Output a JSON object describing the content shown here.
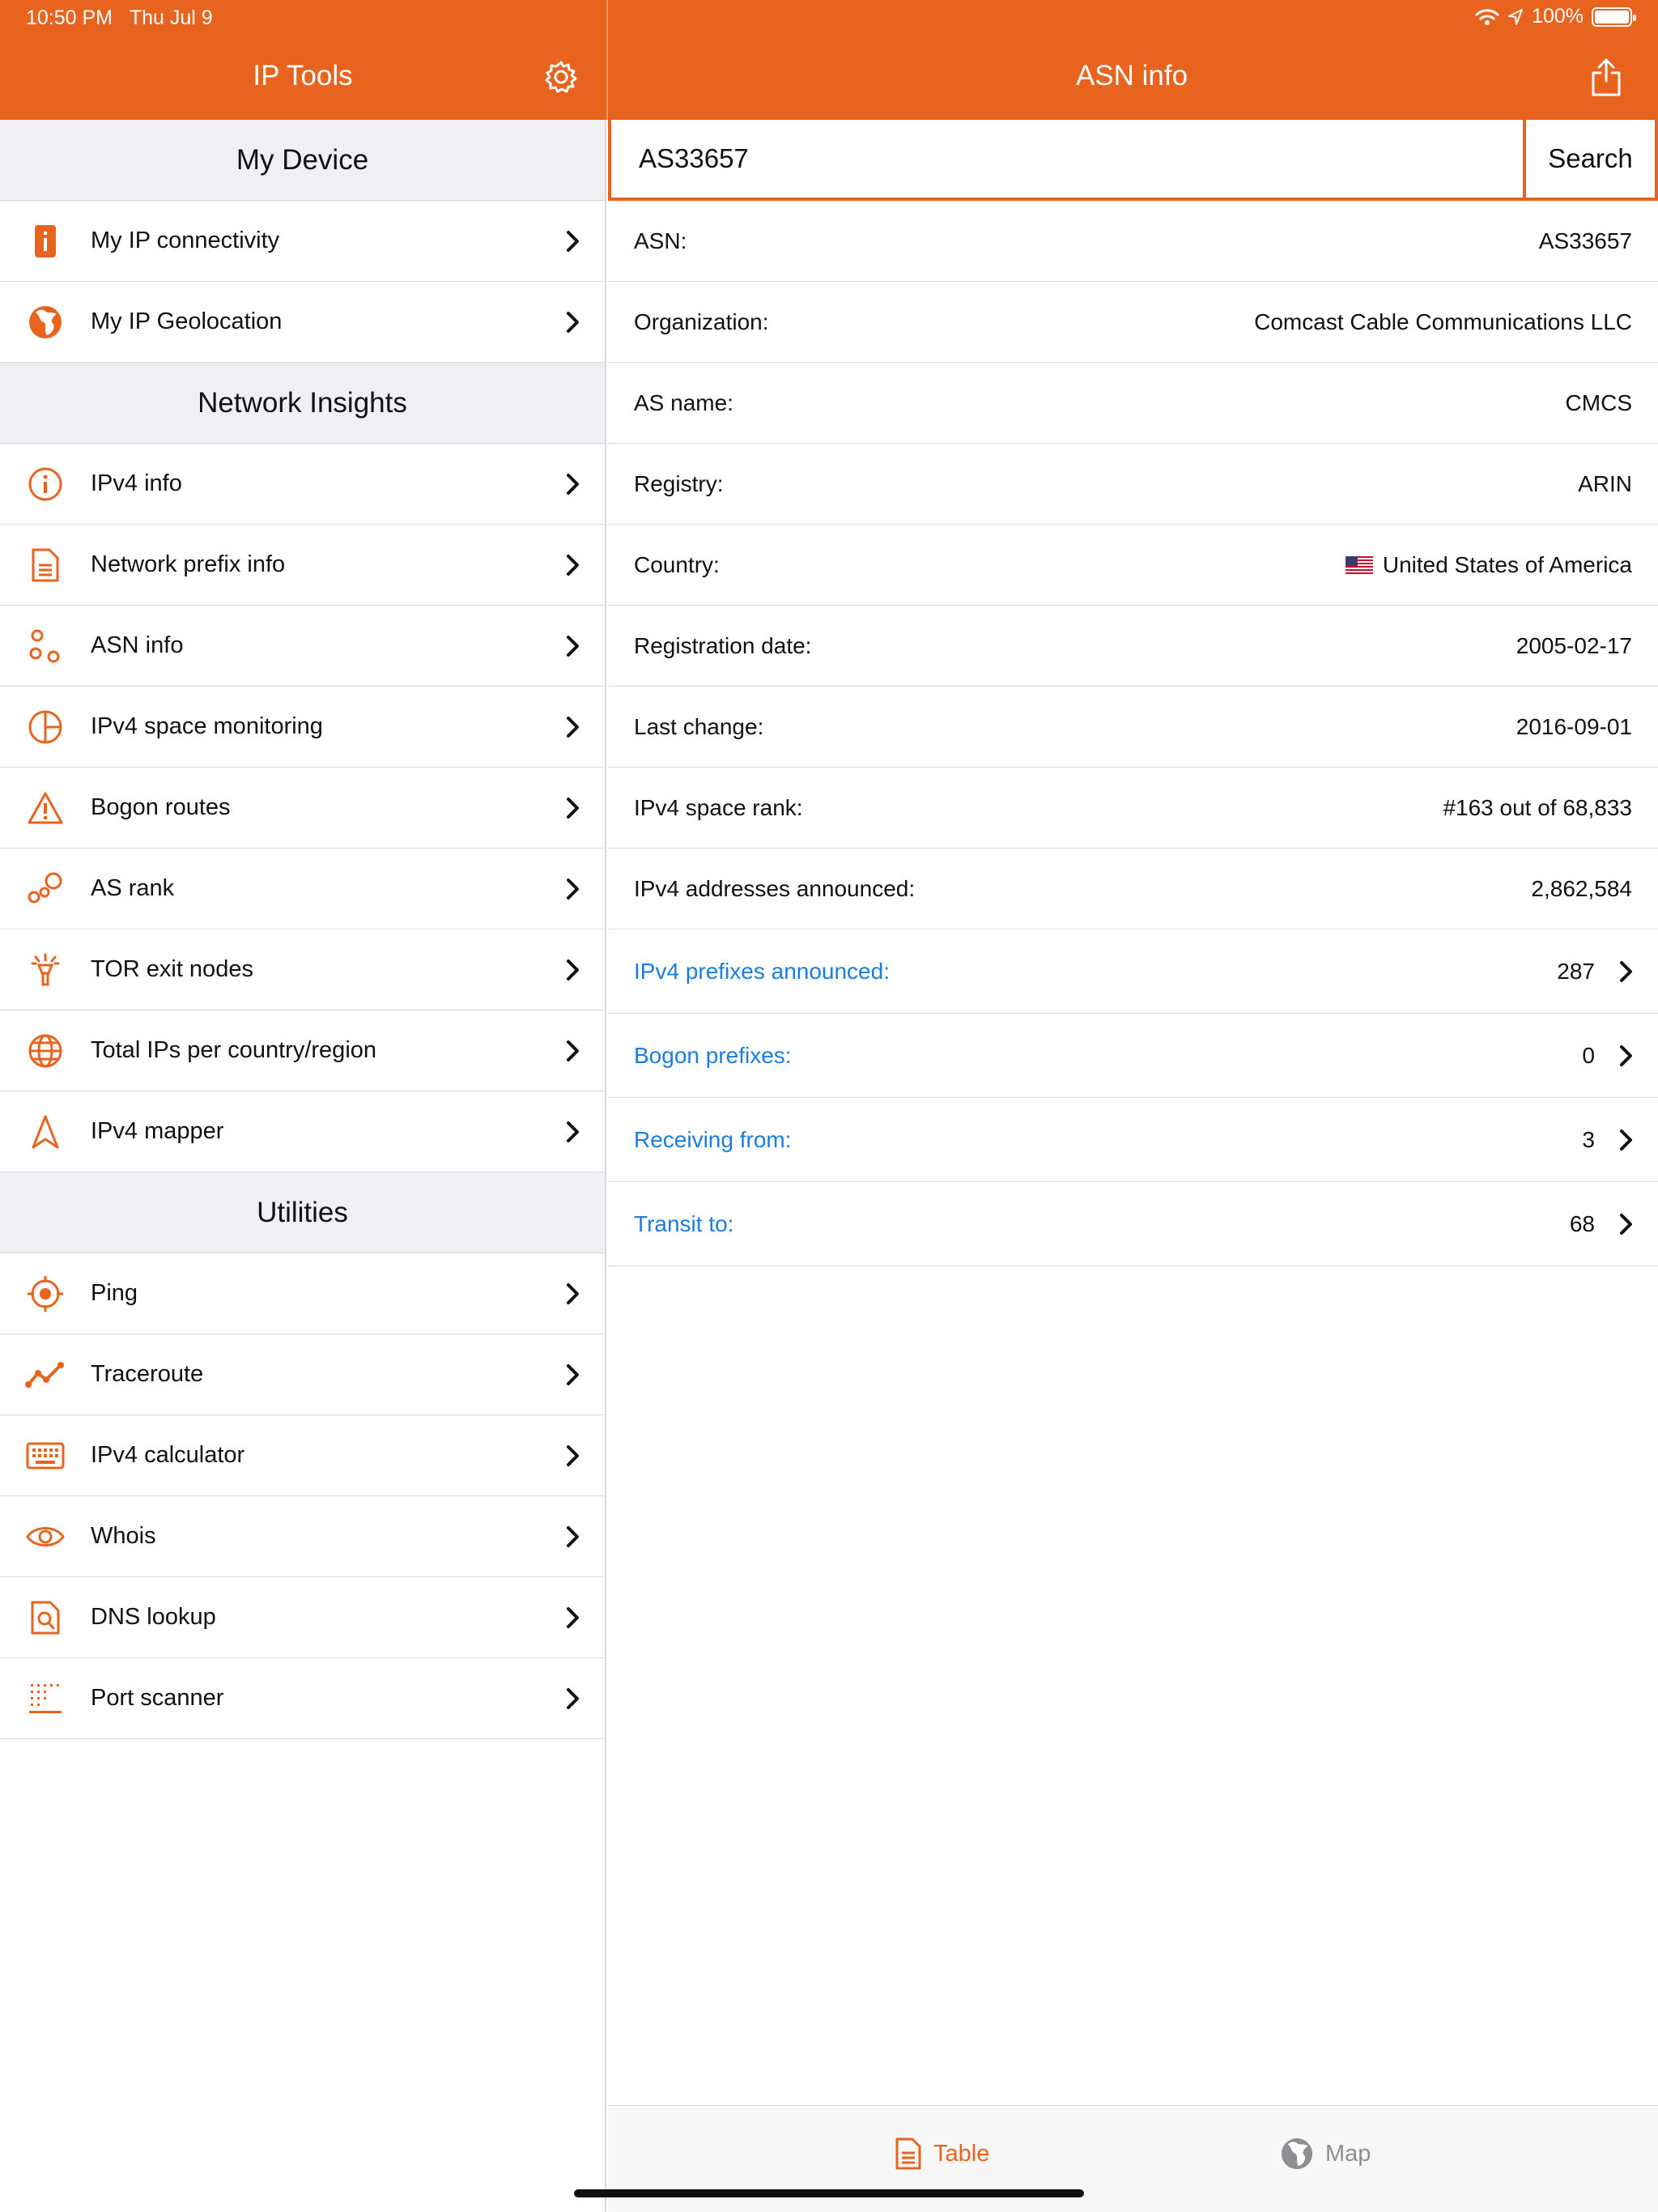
{
  "status_bar": {
    "time": "10:50 PM",
    "date": "Thu Jul 9",
    "battery_text": "100%",
    "battery_level": 1.0
  },
  "nav_left": {
    "title": "IP Tools",
    "settings_icon": "gear-icon"
  },
  "nav_right": {
    "title": "ASN info",
    "share_icon": "share-icon"
  },
  "colors": {
    "accent": "#e8641e",
    "link": "#1a7de0",
    "header_bg": "#efeff4"
  },
  "sidebar": {
    "sections": [
      {
        "title": "My Device",
        "items": [
          {
            "label": "My IP connectivity",
            "icon": "device-info-icon"
          },
          {
            "label": "My IP Geolocation",
            "icon": "globe-icon"
          }
        ]
      },
      {
        "title": "Network Insights",
        "items": [
          {
            "label": "IPv4 info",
            "icon": "info-circle-icon"
          },
          {
            "label": "Network prefix info",
            "icon": "document-icon"
          },
          {
            "label": "ASN info",
            "icon": "asn-nodes-icon"
          },
          {
            "label": "IPv4 space monitoring",
            "icon": "pie-chart-icon"
          },
          {
            "label": "Bogon routes",
            "icon": "warning-icon"
          },
          {
            "label": "AS rank",
            "icon": "bubbles-icon"
          },
          {
            "label": "TOR exit nodes",
            "icon": "torch-icon"
          },
          {
            "label": "Total IPs per country/region",
            "icon": "world-grid-icon"
          },
          {
            "label": "IPv4 mapper",
            "icon": "navigation-arrow-icon"
          }
        ]
      },
      {
        "title": "Utilities",
        "items": [
          {
            "label": "Ping",
            "icon": "target-icon"
          },
          {
            "label": "Traceroute",
            "icon": "route-line-icon"
          },
          {
            "label": "IPv4 calculator",
            "icon": "keyboard-icon"
          },
          {
            "label": "Whois",
            "icon": "eye-icon"
          },
          {
            "label": "DNS lookup",
            "icon": "doc-search-icon"
          },
          {
            "label": "Port scanner",
            "icon": "port-grid-icon"
          }
        ]
      }
    ]
  },
  "search": {
    "value": "AS33657",
    "placeholder": "",
    "button_label": "Search"
  },
  "details": [
    {
      "key": "ASN:",
      "value": "AS33657"
    },
    {
      "key": "Organization:",
      "value": "Comcast Cable Communications LLC"
    },
    {
      "key": "AS name:",
      "value": "CMCS"
    },
    {
      "key": "Registry:",
      "value": "ARIN"
    },
    {
      "key": "Country:",
      "value": "United States of America",
      "icon": "us-flag-icon"
    },
    {
      "key": "Registration date:",
      "value": "2005-02-17"
    },
    {
      "key": "Last change:",
      "value": "2016-09-01"
    },
    {
      "key": "IPv4 space rank:",
      "value": "#163 out of 68,833"
    },
    {
      "key": "IPv4 addresses announced:",
      "value": "2,862,584"
    }
  ],
  "links": [
    {
      "key": "IPv4 prefixes announced:",
      "value": "287"
    },
    {
      "key": "Bogon prefixes:",
      "value": "0"
    },
    {
      "key": "Receiving from:",
      "value": "3"
    },
    {
      "key": "Transit to:",
      "value": "68"
    }
  ],
  "tabbar": {
    "table": {
      "label": "Table",
      "icon": "table-doc-icon",
      "selected": true
    },
    "map": {
      "label": "Map",
      "icon": "globe-icon",
      "selected": false
    }
  }
}
